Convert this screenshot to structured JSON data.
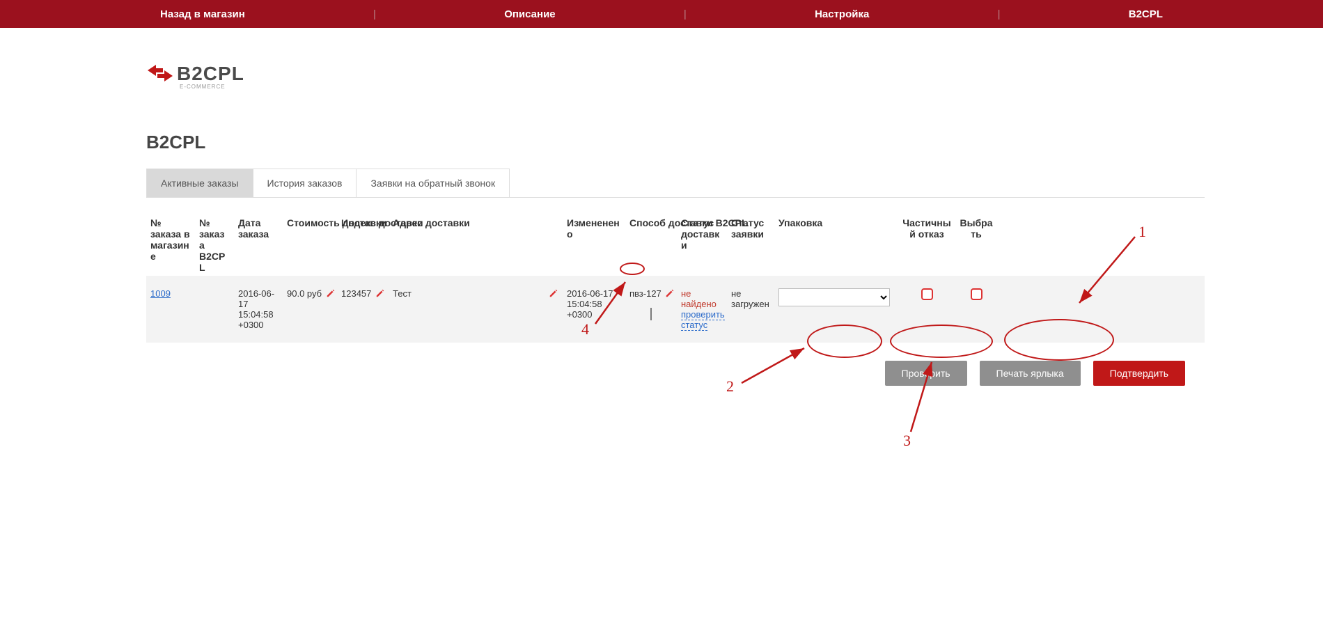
{
  "topnav": {
    "back": "Назад в магазин",
    "desc": "Описание",
    "settings": "Настройка",
    "brand": "B2CPL"
  },
  "logo": {
    "text": "B2CPL",
    "sub": "E-COMMERCE"
  },
  "page_title": "B2CPL",
  "tabs": {
    "active": "Активные заказы",
    "history": "История заказов",
    "callback": "Заявки на обратный звонок"
  },
  "columns": {
    "shop_order": "№ заказа в магазине",
    "b2cpl_order": "№ заказа B2CPL",
    "order_date": "Дата заказа",
    "delivery_cost": "Стоимость доставки",
    "delivery_index": "Индекс доставки",
    "delivery_address": "Адрес доставки",
    "changed": "Измененено",
    "delivery_method": "Способ доставки B2CPL",
    "delivery_status": "Статус доставки",
    "request_status": "Статус заявки",
    "packaging": "Упаковка",
    "partial_refuse": "Частичный отказ",
    "select": "Выбрать"
  },
  "row": {
    "shop_order": "1009",
    "b2cpl_order": "",
    "order_date": "2016-06-17 15:04:58 +0300",
    "delivery_cost": "90.0 руб",
    "delivery_index": "123457",
    "delivery_address": "Тест",
    "changed": "2016-06-17 15:04:58 +0300",
    "delivery_method": "пвз-127",
    "delivery_status_notfound": "не найдено",
    "delivery_status_link": "проверить статус",
    "request_status": "не загружен",
    "packaging_selected": ""
  },
  "actions": {
    "check": "Проверить",
    "print": "Печать ярлыка",
    "confirm": "Подтвердить"
  },
  "annotations": {
    "n1": "1",
    "n2": "2",
    "n3": "3",
    "n4": "4"
  }
}
